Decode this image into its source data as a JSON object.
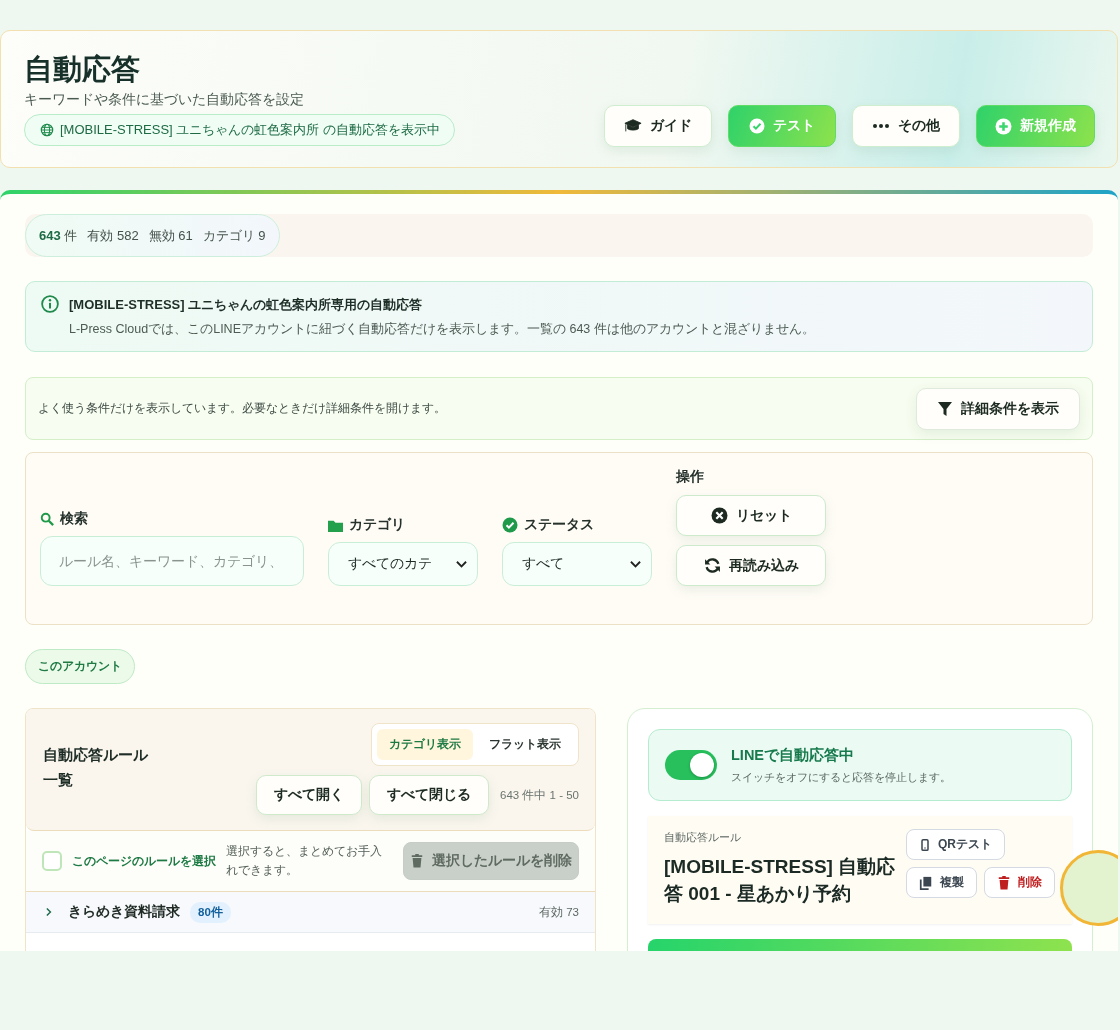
{
  "header": {
    "title": "自動応答",
    "subtitle": "キーワードや条件に基づいた自動応答を設定",
    "account_chip": "[MOBILE-STRESS] ユニちゃんの虹色案内所 の自動応答を表示中",
    "buttons": [
      {
        "label": "ガイド",
        "kind": "plain"
      },
      {
        "label": "テスト",
        "kind": "primary"
      },
      {
        "label": "その他",
        "kind": "plain"
      },
      {
        "label": "新規作成",
        "kind": "primary"
      }
    ]
  },
  "summary": {
    "total": "643",
    "total_unit": "件",
    "stats": [
      "有効 582",
      "無効 61",
      "カテゴリ 9"
    ]
  },
  "notice": {
    "title": "[MOBILE-STRESS] ユニちゃんの虹色案内所専用の自動応答",
    "body": "L-Press Cloudでは、このLINEアカウントに紐づく自動応答だけを表示します。一覧の 643 件は他のアカウントと混ざりません。"
  },
  "filter_hint": {
    "text": "よく使う条件だけを表示しています。必要なときだけ詳細条件を開けます。",
    "button": "詳細条件を表示"
  },
  "filters": {
    "search": {
      "label": "検索",
      "placeholder": "ルール名、キーワード、カテゴリ、"
    },
    "category": {
      "label": "カテゴリ",
      "value": "すべてのカテ"
    },
    "status": {
      "label": "ステータス",
      "value": "すべて"
    },
    "actions": {
      "label": "操作",
      "buttons": [
        "リセット",
        "再読み込み"
      ]
    }
  },
  "scope_chip": "このアカウント",
  "rule_list": {
    "title": "自動応答ルール一覧",
    "view_tabs": [
      {
        "label": "カテゴリ表示",
        "selected": true
      },
      {
        "label": "フラット表示",
        "selected": false
      }
    ],
    "buttons": [
      "すべて開く",
      "すべて閉じる"
    ],
    "range": "643 件中 1 - 50",
    "select_all": {
      "label": "このページのルールを選択",
      "checked": false
    },
    "select_hint": "選択すると、まとめてお手入れできます。",
    "delete_button": {
      "label": "選択したルールを削除",
      "disabled": true
    },
    "categories": [
      {
        "name": "きらめき資料請求",
        "count": "80件",
        "expanded": false,
        "active_count": "有効 73"
      }
    ]
  },
  "detail": {
    "toggle": {
      "label": "LINEで自動応答中",
      "hint": "スイッチをオフにすると応答を停止します。",
      "on": true
    },
    "rule": {
      "eyebrow": "自動応答ルール",
      "title": "[MOBILE-STRESS] 自動応答 001 - 星あかり予約",
      "actions": [
        {
          "label": "QRテスト",
          "kind": "neutral"
        },
        {
          "label": "複製",
          "kind": "neutral"
        },
        {
          "label": "削除",
          "kind": "danger"
        }
      ]
    }
  }
}
